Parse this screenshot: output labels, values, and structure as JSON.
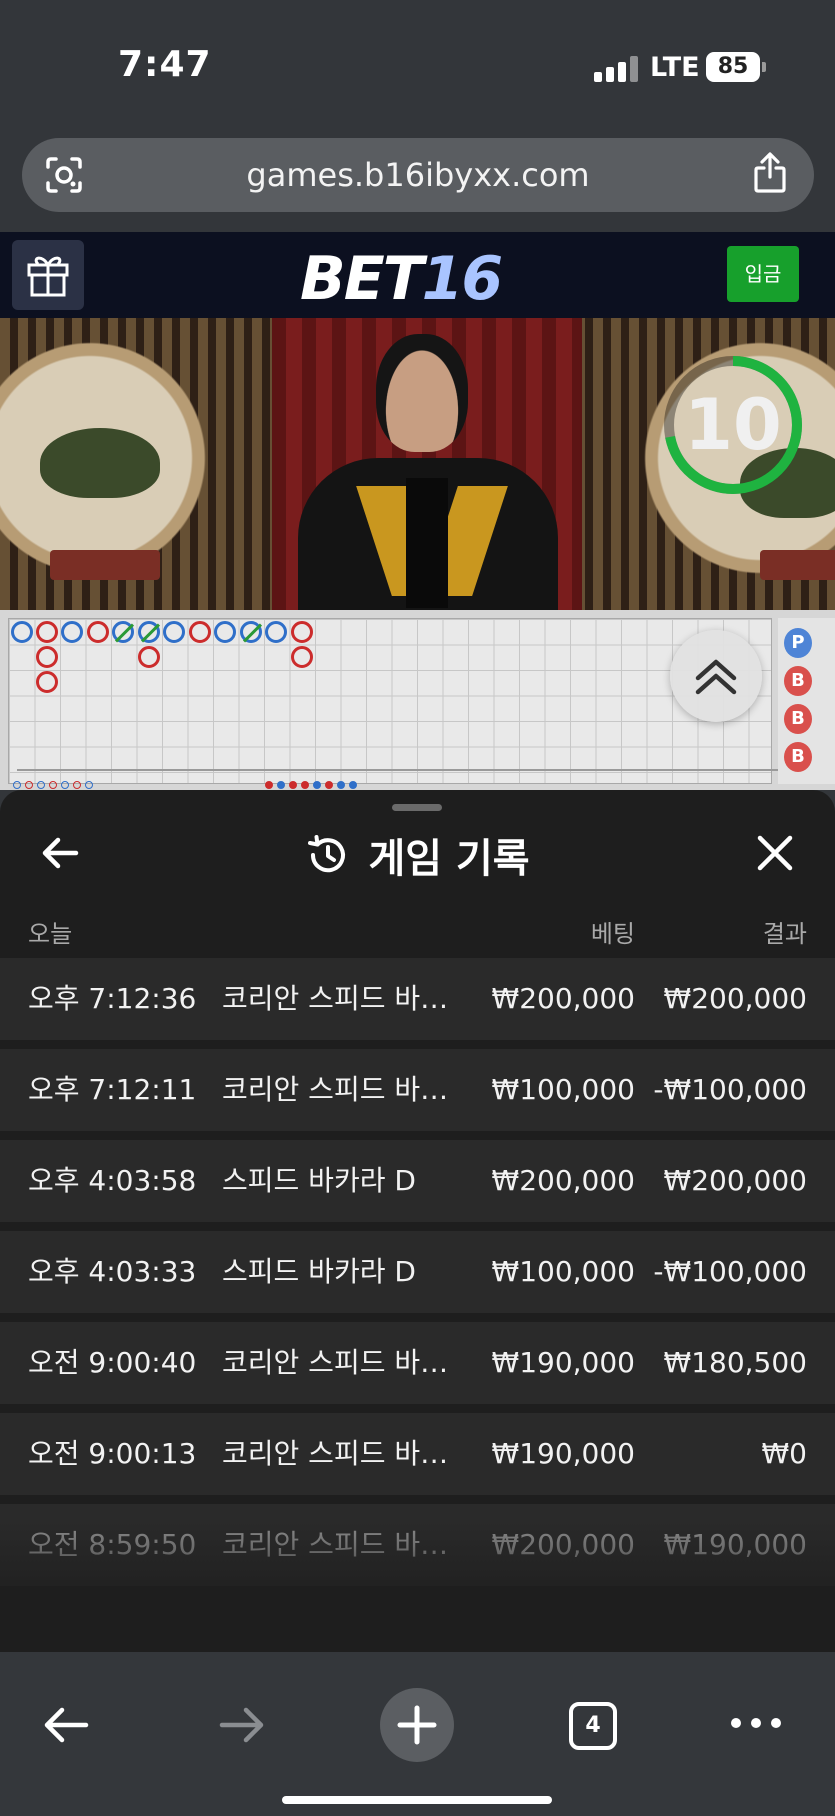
{
  "status_bar": {
    "time": "7:47",
    "network": "LTE",
    "battery": "85"
  },
  "browser": {
    "url": "games.b16ibyxx.com",
    "tab_count": "4"
  },
  "site": {
    "logo_part1": "BET",
    "logo_part2": "16",
    "deposit_label": "입금"
  },
  "video": {
    "timer_value": "10",
    "timer_progress": 0.72
  },
  "roadmap": {
    "side_labels": [
      "P",
      "B",
      "B",
      "B"
    ]
  },
  "history": {
    "title": "게임 기록",
    "col_date": "오늘",
    "col_bet": "베팅",
    "col_result": "결과",
    "rows": [
      {
        "time": "오후 7:12:36",
        "game": "코리안 스피드 바카라",
        "bet": "₩200,000",
        "result": "₩200,000"
      },
      {
        "time": "오후 7:12:11",
        "game": "코리안 스피드 바카라",
        "bet": "₩100,000",
        "result": "-₩100,000"
      },
      {
        "time": "오후 4:03:58",
        "game": "스피드 바카라 D",
        "bet": "₩200,000",
        "result": "₩200,000"
      },
      {
        "time": "오후 4:03:33",
        "game": "스피드 바카라 D",
        "bet": "₩100,000",
        "result": "-₩100,000"
      },
      {
        "time": "오전 9:00:40",
        "game": "코리안 스피드 바카라",
        "bet": "₩190,000",
        "result": "₩180,500"
      },
      {
        "time": "오전 9:00:13",
        "game": "코리안 스피드 바카라",
        "bet": "₩190,000",
        "result": "₩0"
      },
      {
        "time": "오전 8:59:50",
        "game": "코리안 스피드 바카라",
        "bet": "₩200,000",
        "result": "₩190,000"
      }
    ]
  }
}
